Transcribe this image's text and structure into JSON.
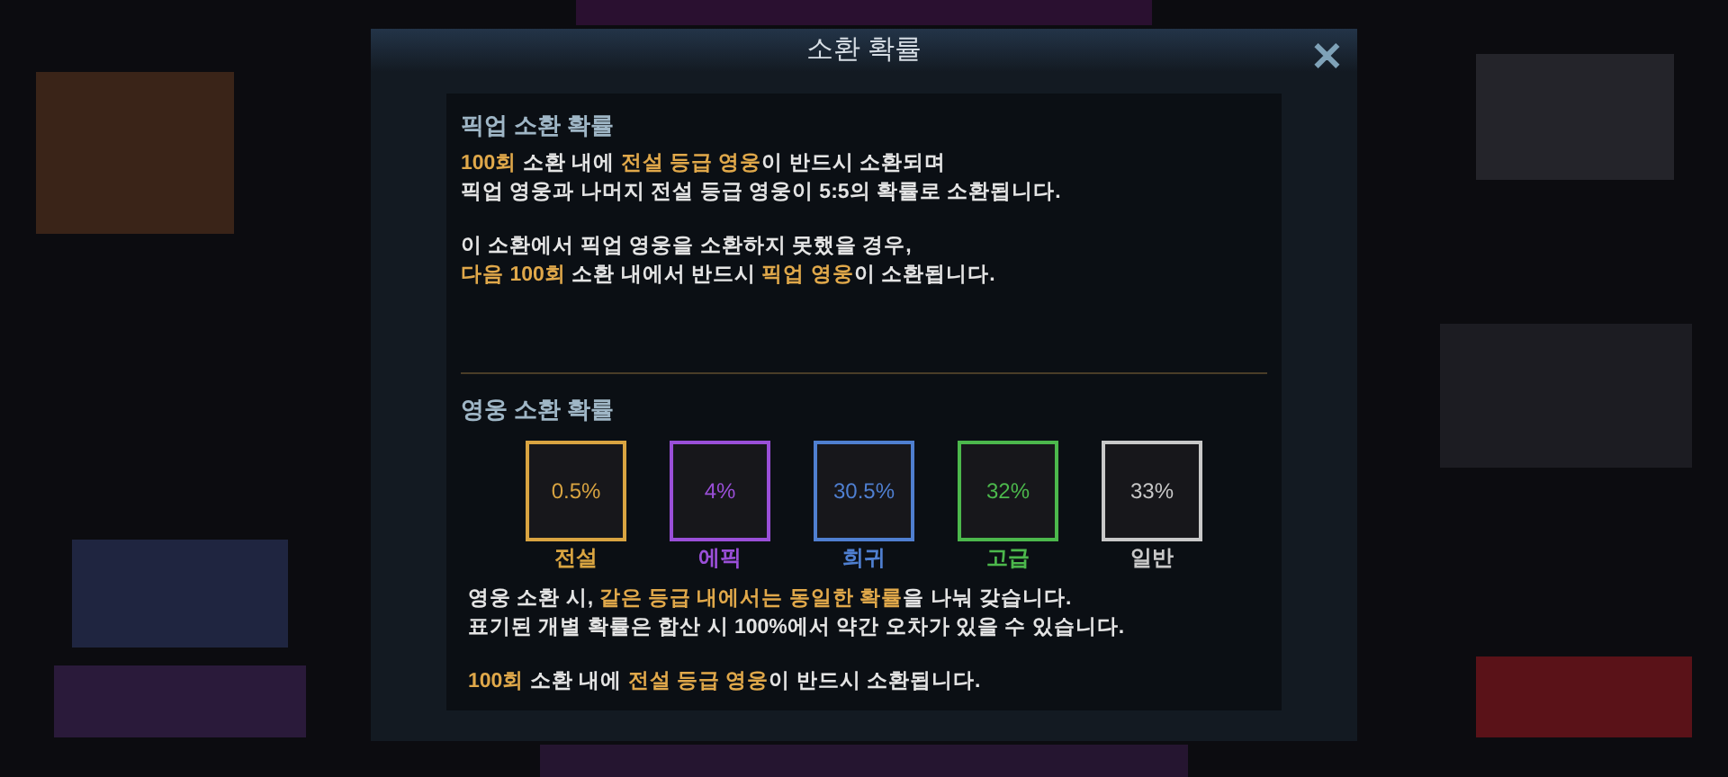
{
  "dialog": {
    "title": "소환 확률",
    "close": "✕"
  },
  "pickup": {
    "heading": "픽업 소환 확률",
    "paragraphs": [
      [
        [
          {
            "text": "100회",
            "hl": true
          },
          {
            "text": " 소환 내에 ",
            "hl": false
          },
          {
            "text": "전설 등급 영웅",
            "hl": true
          },
          {
            "text": "이 반드시 소환되며",
            "hl": false
          }
        ],
        [
          {
            "text": "픽업 영웅과 나머지 전설 등급 영웅이 5:5의 확률로 소환됩니다.",
            "hl": false
          }
        ]
      ],
      [
        [
          {
            "text": "이 소환에서 픽업 영웅을 소환하지 못했을 경우,",
            "hl": false
          }
        ],
        [
          {
            "text": "다음 100회",
            "hl": true
          },
          {
            "text": " 소환 내에서 반드시 ",
            "hl": false
          },
          {
            "text": "픽업 영웅",
            "hl": true
          },
          {
            "text": "이 소환됩니다.",
            "hl": false
          }
        ]
      ]
    ]
  },
  "hero": {
    "heading": "영웅 소환 확률",
    "grades": [
      {
        "label": "전설",
        "rate": "0.5%",
        "color": "#d9a441"
      },
      {
        "label": "에픽",
        "rate": "4%",
        "color": "#9a4fd8"
      },
      {
        "label": "희귀",
        "rate": "30.5%",
        "color": "#4f7fd0"
      },
      {
        "label": "고급",
        "rate": "32%",
        "color": "#4cb84c"
      },
      {
        "label": "일반",
        "rate": "33%",
        "color": "#c8c8c8"
      }
    ],
    "paragraphs": [
      [
        [
          {
            "text": "영웅 소환 시, ",
            "hl": false
          },
          {
            "text": "같은 등급 내에서는 동일한 확률",
            "hl": true
          },
          {
            "text": "을 나눠 갖습니다.",
            "hl": false
          }
        ],
        [
          {
            "text": "표기된 개별 확률은 합산 시 100%에서 약간 오차가 있을 수 있습니다.",
            "hl": false
          }
        ]
      ],
      [
        [
          {
            "text": "100회",
            "hl": true
          },
          {
            "text": " 소환 내에 ",
            "hl": false
          },
          {
            "text": "전설 등급 영웅",
            "hl": true
          },
          {
            "text": "이 반드시 소환됩니다.",
            "hl": false
          }
        ]
      ]
    ]
  }
}
